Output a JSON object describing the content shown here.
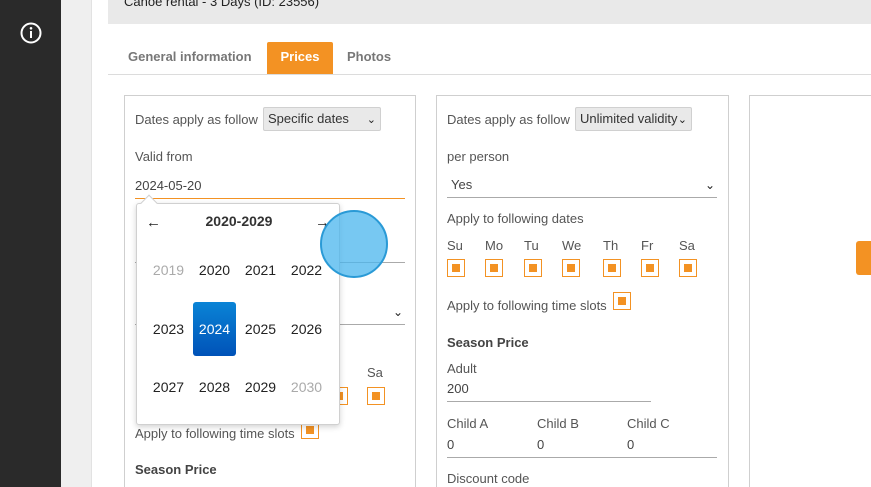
{
  "header": {
    "title": "Canoe rental - 3 Days (ID: 23556)"
  },
  "rail": {
    "info_icon": "info-circle-icon"
  },
  "tabs": [
    {
      "label": "General information",
      "active": false
    },
    {
      "label": "Prices",
      "active": true
    },
    {
      "label": "Photos",
      "active": false
    }
  ],
  "panel1": {
    "dates_apply_label": "Dates apply as follow",
    "dates_apply_value": "Specific dates",
    "valid_from_label": "Valid from",
    "valid_from_value": "2024-05-20",
    "sa_label": "Sa",
    "time_slots_label": "Apply to following time slots",
    "season_price_label": "Season Price"
  },
  "panel2": {
    "dates_apply_label": "Dates apply as follow",
    "dates_apply_value": "Unlimited validity",
    "per_person_label": "per person",
    "per_person_value": "Yes",
    "apply_dates_label": "Apply to following dates",
    "days": [
      "Su",
      "Mo",
      "Tu",
      "We",
      "Th",
      "Fr",
      "Sa"
    ],
    "time_slots_label": "Apply to following time slots",
    "season_price_label": "Season Price",
    "adult_label": "Adult",
    "adult_value": "200",
    "child_a_label": "Child A",
    "child_a_value": "0",
    "child_b_label": "Child B",
    "child_b_value": "0",
    "child_c_label": "Child C",
    "child_c_value": "0",
    "discount_label": "Discount code"
  },
  "year_picker": {
    "prev_icon": "arrow-left-icon",
    "next_icon": "arrow-right-icon",
    "decade": "2020-2029",
    "years": [
      "2019",
      "2020",
      "2021",
      "2022",
      "2023",
      "2024",
      "2025",
      "2026",
      "2027",
      "2028",
      "2029",
      "2030"
    ],
    "selected": "2024"
  },
  "colors": {
    "accent": "#f39223",
    "selected": "#0a6fd0",
    "rail": "#2a2a2a"
  }
}
